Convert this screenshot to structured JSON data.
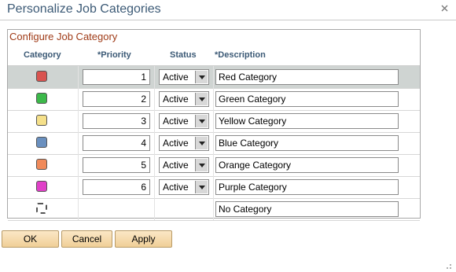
{
  "dialog": {
    "title": "Personalize Job Categories",
    "close_icon": "close-icon"
  },
  "grid": {
    "caption": "Configure Job Category",
    "columns": {
      "category": "Category",
      "priority": "*Priority",
      "status": "Status",
      "description": "*Description"
    },
    "rows": [
      {
        "color": "#d9534f",
        "priority": "1",
        "status": "Active",
        "description": "Red Category",
        "selected": true
      },
      {
        "color": "#3cb94a",
        "priority": "2",
        "status": "Active",
        "description": "Green Category"
      },
      {
        "color": "#f5e08a",
        "priority": "3",
        "status": "Active",
        "description": "Yellow Category"
      },
      {
        "color": "#6a90bf",
        "priority": "4",
        "status": "Active",
        "description": "Blue Category"
      },
      {
        "color": "#f08a5a",
        "priority": "5",
        "status": "Active",
        "description": "Orange Category"
      },
      {
        "color": "#e040c8",
        "priority": "6",
        "status": "Active",
        "description": "Purple Category"
      }
    ],
    "none_row": {
      "description": "No Category"
    }
  },
  "buttons": {
    "ok": "OK",
    "cancel": "Cancel",
    "apply": "Apply"
  },
  "colors": {
    "title": "#3c5a76",
    "caption": "#9f3a16",
    "header": "#3c5a76",
    "button_bg": "#f0cf97",
    "selected_row": "#cfd4d2"
  }
}
